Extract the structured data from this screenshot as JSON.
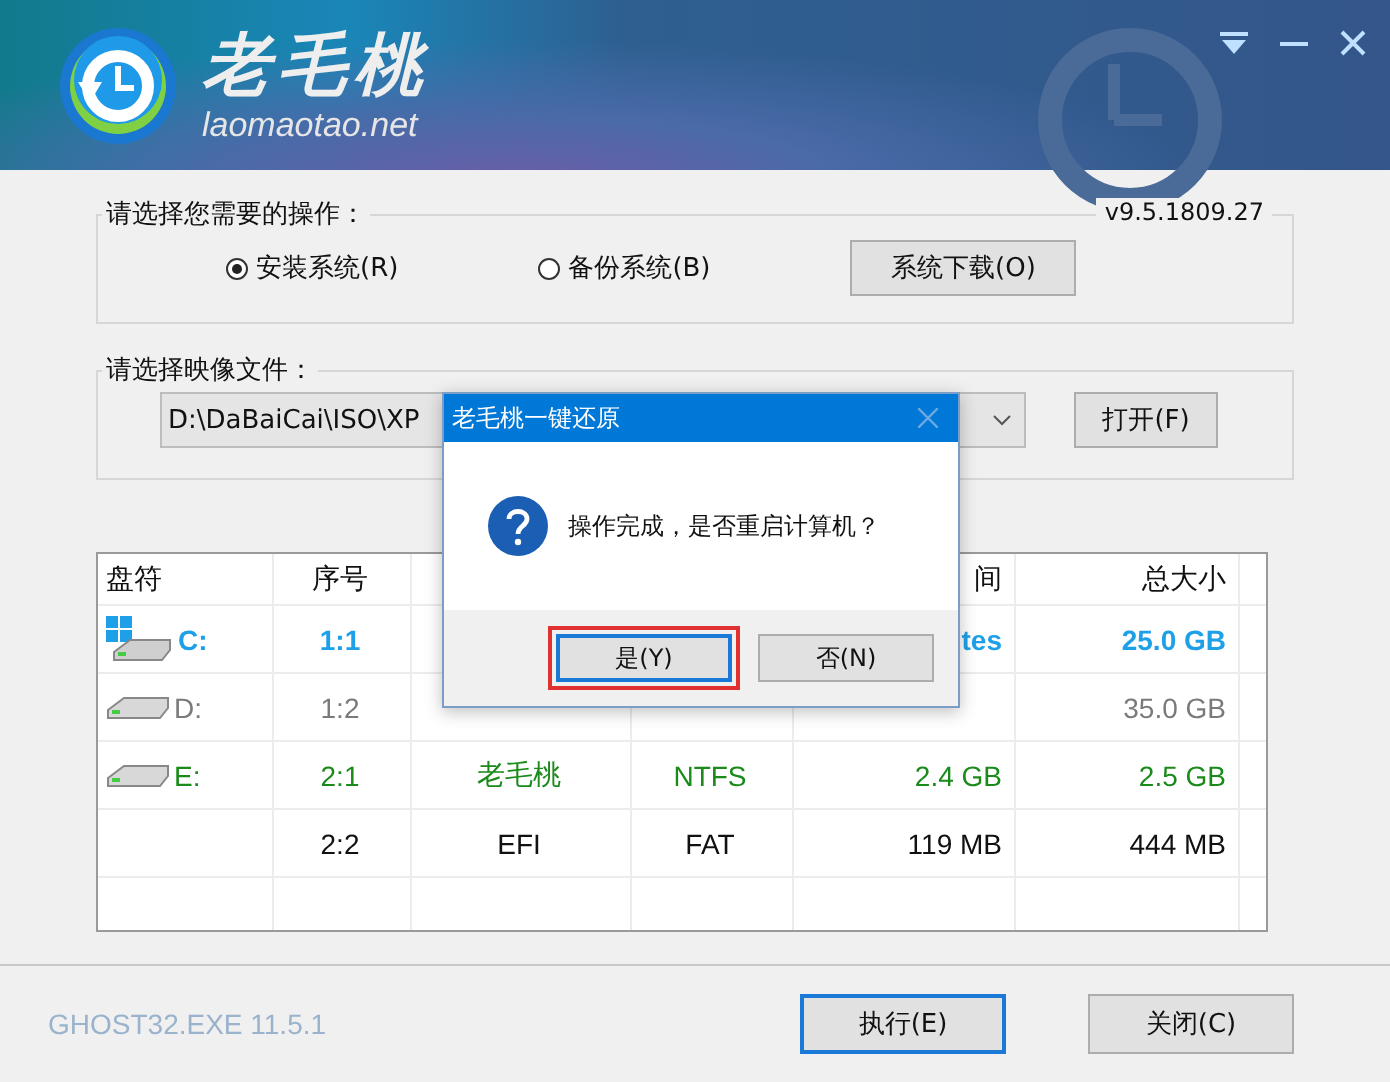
{
  "header": {
    "logo_text": "老毛桃",
    "site": "laomaotao.net"
  },
  "operation": {
    "title": "请选择您需要的操作：",
    "version": "v9.5.1809.27",
    "options": [
      {
        "label": "安装系统(R)",
        "selected": true
      },
      {
        "label": "备份系统(B)",
        "selected": false
      }
    ],
    "download_button": "系统下载(O)"
  },
  "image": {
    "title": "请选择映像文件：",
    "value": "D:\\DaBaiCai\\ISO\\XP",
    "open_button": "打开(F)"
  },
  "table": {
    "columns": [
      {
        "label": "盘符"
      },
      {
        "label": "序号"
      },
      {
        "label": "间"
      },
      {
        "label": "总大小"
      }
    ],
    "rows": [
      {
        "kind": "system",
        "color": "#1ea0e8",
        "drive": "C:",
        "index": "1:1",
        "free": "tes",
        "total": "25.0 GB"
      },
      {
        "kind": "drive",
        "color": "#7a7a7a",
        "drive": "D:",
        "index": "1:2",
        "total": "35.0 GB"
      },
      {
        "kind": "drive",
        "color": "#1a8a1a",
        "drive": "E:",
        "index": "2:1",
        "label": "老毛桃",
        "fs": "NTFS",
        "free": "2.4 GB",
        "total": "2.5 GB"
      },
      {
        "kind": "none",
        "color": "#111111",
        "index": "2:2",
        "label": "EFI",
        "fs": "FAT",
        "free": "119 MB",
        "total": "444 MB"
      }
    ]
  },
  "footer": {
    "version": "GHOST32.EXE 11.5.1",
    "buttons": [
      {
        "label": "执行(E)",
        "focused": true
      },
      {
        "label": "关闭(C)",
        "focused": false
      }
    ]
  },
  "dialog": {
    "title": "老毛桃一键还原",
    "message": "操作完成，是否重启计算机？",
    "buttons": [
      {
        "label": "是(Y)",
        "focused": true
      },
      {
        "label": "否(N)",
        "focused": false
      }
    ]
  }
}
